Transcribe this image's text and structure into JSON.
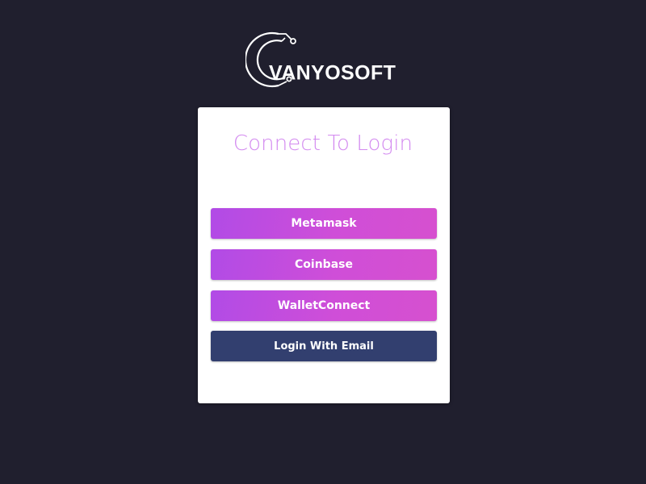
{
  "brand": {
    "name": "VANYOSOFT",
    "logo_icon": "circuit-arc-icon"
  },
  "login_card": {
    "title": "Connect To Login",
    "buttons": [
      {
        "label": "Metamask"
      },
      {
        "label": "Coinbase"
      },
      {
        "label": "WalletConnect"
      },
      {
        "label": "Login With Email"
      }
    ]
  },
  "colors": {
    "background": "#201f2e",
    "card": "#ffffff",
    "title": "#d38af0",
    "wallet_button_gradient_start": "#b14be6",
    "wallet_button_gradient_end": "#d650cf",
    "email_button": "#323f6f"
  }
}
